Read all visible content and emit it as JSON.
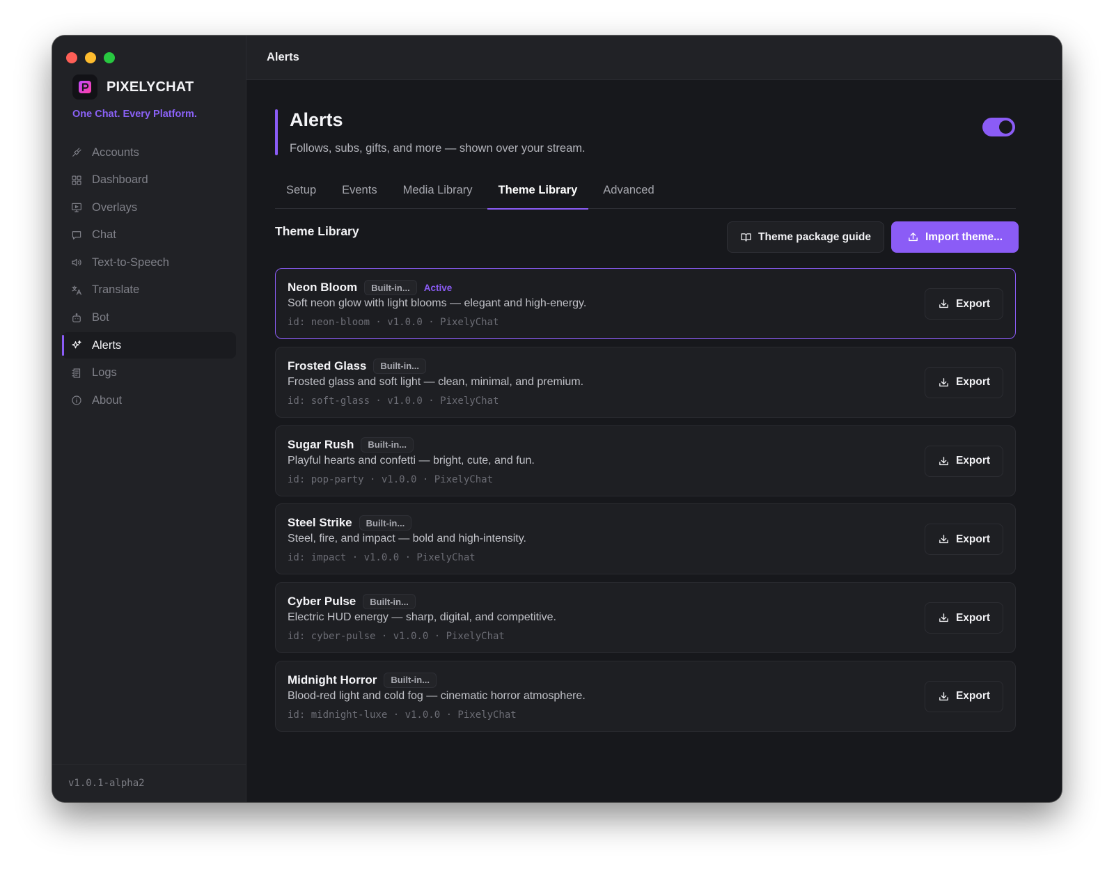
{
  "window": {
    "title": "Alerts"
  },
  "brand": {
    "name": "PIXELYCHAT",
    "tagline": "One Chat. Every Platform."
  },
  "sidebar": {
    "items": [
      {
        "label": "Accounts",
        "icon": "plug-icon"
      },
      {
        "label": "Dashboard",
        "icon": "dashboard-grid-icon"
      },
      {
        "label": "Overlays",
        "icon": "monitor-icon"
      },
      {
        "label": "Chat",
        "icon": "chat-bubble-icon"
      },
      {
        "label": "Text-to-Speech",
        "icon": "speaker-icon"
      },
      {
        "label": "Translate",
        "icon": "translate-icon"
      },
      {
        "label": "Bot",
        "icon": "bot-icon"
      },
      {
        "label": "Alerts",
        "icon": "sparkle-icon",
        "active": true
      },
      {
        "label": "Logs",
        "icon": "logs-icon"
      },
      {
        "label": "About",
        "icon": "info-icon"
      }
    ],
    "version": "v1.0.1-alpha2"
  },
  "header": {
    "title": "Alerts",
    "subtitle": "Follows, subs, gifts, and more — shown over your stream.",
    "enabled": true
  },
  "tabs": [
    {
      "label": "Setup"
    },
    {
      "label": "Events"
    },
    {
      "label": "Media Library"
    },
    {
      "label": "Theme Library",
      "active": true
    },
    {
      "label": "Advanced"
    }
  ],
  "library": {
    "title": "Theme Library",
    "guide_label": "Theme package guide",
    "import_label": "Import theme...",
    "export_label": "Export",
    "builtin_label": "Built-in...",
    "active_label": "Active",
    "themes": [
      {
        "name": "Neon Bloom",
        "active": true,
        "description": "Soft neon glow with light blooms — elegant and high-energy.",
        "meta": "id: neon-bloom · v1.0.0 · PixelyChat"
      },
      {
        "name": "Frosted Glass",
        "active": false,
        "description": "Frosted glass and soft light — clean, minimal, and premium.",
        "meta": "id: soft-glass · v1.0.0 · PixelyChat"
      },
      {
        "name": "Sugar Rush",
        "active": false,
        "description": "Playful hearts and confetti — bright, cute, and fun.",
        "meta": "id: pop-party · v1.0.0 · PixelyChat"
      },
      {
        "name": "Steel Strike",
        "active": false,
        "description": "Steel, fire, and impact — bold and high-intensity.",
        "meta": "id: impact · v1.0.0 · PixelyChat"
      },
      {
        "name": "Cyber Pulse",
        "active": false,
        "description": "Electric HUD energy — sharp, digital, and competitive.",
        "meta": "id: cyber-pulse · v1.0.0 · PixelyChat"
      },
      {
        "name": "Midnight Horror",
        "active": false,
        "description": "Blood-red light and cold fog — cinematic horror atmosphere.",
        "meta": "id: midnight-luxe · v1.0.0 · PixelyChat"
      }
    ]
  },
  "colors": {
    "accent": "#8b5cf6",
    "background": "#17181c",
    "sidebar": "#212226"
  }
}
